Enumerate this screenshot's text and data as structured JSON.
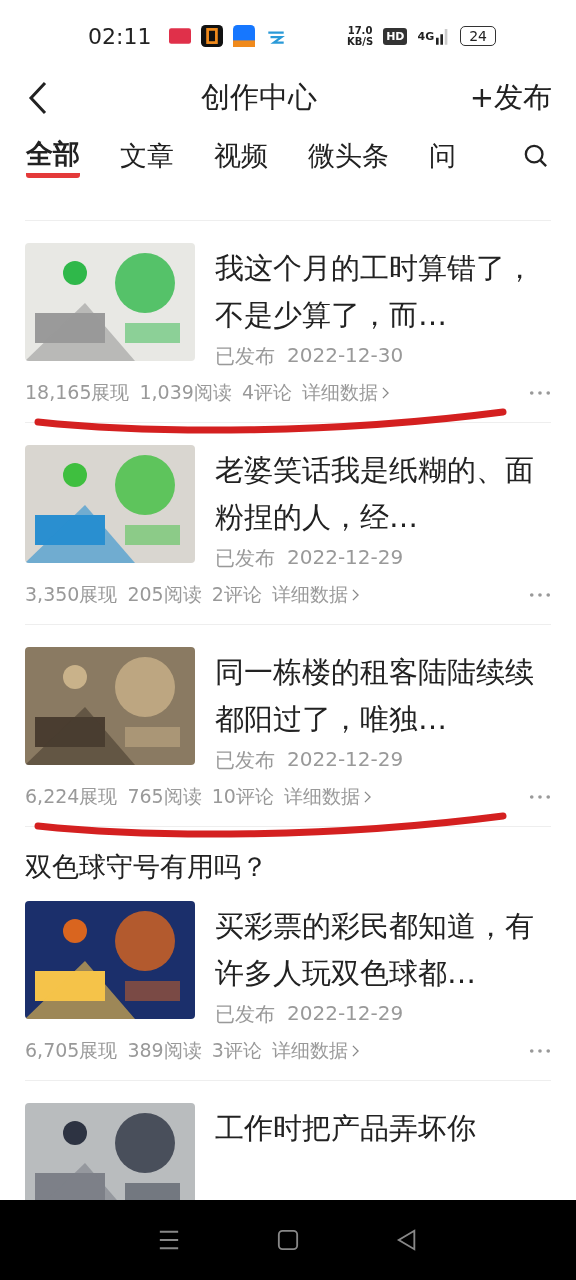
{
  "status_bar": {
    "time": "02:11",
    "speed": "17.0",
    "speed_unit": "KB/S",
    "hd": "HD",
    "network": "4G",
    "battery": "24"
  },
  "header": {
    "title": "创作中心",
    "action": "+发布"
  },
  "tabs": [
    {
      "label": "全部",
      "selected": true
    },
    {
      "label": "文章",
      "selected": false
    },
    {
      "label": "视频",
      "selected": false
    },
    {
      "label": "微头条",
      "selected": false
    },
    {
      "label": "问",
      "selected": false
    }
  ],
  "articles": [
    {
      "title": "我这个月的工时算错了，不是少算了，而…",
      "status": "已发布",
      "date": "2022-12-30",
      "stats": [
        "18,165展现",
        "1,039阅读",
        "4评论"
      ],
      "details": "详细数据",
      "underlined": true
    },
    {
      "title": "老婆笑话我是纸糊的、面粉捏的人，经…",
      "status": "已发布",
      "date": "2022-12-29",
      "stats": [
        "3,350展现",
        "205阅读",
        "2评论"
      ],
      "details": "详细数据",
      "underlined": false
    },
    {
      "title": "同一栋楼的租客陆陆续续都阳过了，唯独…",
      "status": "已发布",
      "date": "2022-12-29",
      "stats": [
        "6,224展现",
        "765阅读",
        "10评论"
      ],
      "details": "详细数据",
      "underlined": true
    },
    {
      "heading": "双色球守号有用吗？",
      "title": "买彩票的彩民都知道，有许多人玩双色球都…",
      "status": "已发布",
      "date": "2022-12-29",
      "stats": [
        "6,705展现",
        "389阅读",
        "3评论"
      ],
      "details": "详细数据",
      "underlined": false
    },
    {
      "title": "工作时把产品弄坏你",
      "underlined": false
    }
  ]
}
